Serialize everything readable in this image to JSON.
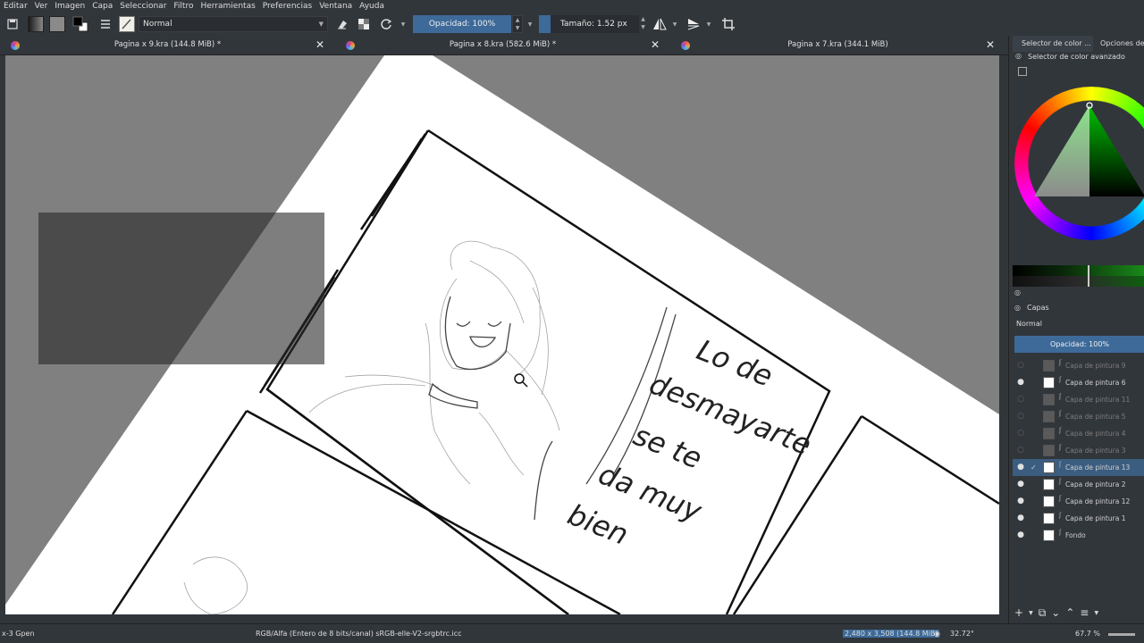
{
  "menu": [
    "Editar",
    "Ver",
    "Imagen",
    "Capa",
    "Seleccionar",
    "Filtro",
    "Herramientas",
    "Preferencias",
    "Ventana",
    "Ayuda"
  ],
  "toolbar": {
    "blend_mode": "Normal",
    "opacity_label": "Opacidad: 100%",
    "opacity_value": 1.0,
    "size_label": "Tamaño: 1.52 px",
    "size_fill_fraction": 0.12
  },
  "tabs": [
    {
      "name": "Pagina x 9.kra (144.8 MiB) *",
      "close": "✕"
    },
    {
      "name": "Pagina x 8.kra (582.6 MiB) *",
      "close": "✕"
    },
    {
      "name": "Pagina x 7.kra (344.1 MiB)",
      "close": "✕"
    }
  ],
  "docker": {
    "tab1": "Selector de color ...",
    "tab2": "Opciones de h",
    "color_panel_title": "Selector de color avanzado",
    "current_color": "#4db84d",
    "layers_title": "Capas",
    "layers_blend": "Normal",
    "layers_opacity": "Opacidad:  100%",
    "layers": [
      {
        "name": "Capa de pintura 9",
        "visible": false,
        "selected": false,
        "thumb": "dim"
      },
      {
        "name": "Capa de pintura 6",
        "visible": true,
        "selected": false,
        "thumb": "white"
      },
      {
        "name": "Capa de pintura 11",
        "visible": false,
        "selected": false,
        "thumb": "dim"
      },
      {
        "name": "Capa de pintura 5",
        "visible": false,
        "selected": false,
        "thumb": "dim"
      },
      {
        "name": "Capa de pintura 4",
        "visible": false,
        "selected": false,
        "thumb": "dim"
      },
      {
        "name": "Capa de pintura 3",
        "visible": false,
        "selected": false,
        "thumb": "dim"
      },
      {
        "name": "Capa de pintura 13",
        "visible": true,
        "selected": true,
        "thumb": "white"
      },
      {
        "name": "Capa de pintura 2",
        "visible": true,
        "selected": false,
        "thumb": "white"
      },
      {
        "name": "Capa de pintura 12",
        "visible": true,
        "selected": false,
        "thumb": "white"
      },
      {
        "name": "Capa de pintura 1",
        "visible": true,
        "selected": false,
        "thumb": "white"
      },
      {
        "name": "Fondo",
        "visible": true,
        "selected": false,
        "thumb": "white"
      }
    ]
  },
  "canvas": {
    "handwritten_text": [
      "Lo de",
      "desmayarte",
      "se te",
      "da muy",
      "bien"
    ]
  },
  "status": {
    "brush": "x-3 Gpen",
    "color_space": "RGB/Alfa (Entero de 8 bits/canal)  sRGB-elle-V2-srgbtrc.icc",
    "dimensions": "2,480 x 3,508 (144.8 MiB)",
    "rotation": "32.72°",
    "zoom": "67.7 %"
  }
}
